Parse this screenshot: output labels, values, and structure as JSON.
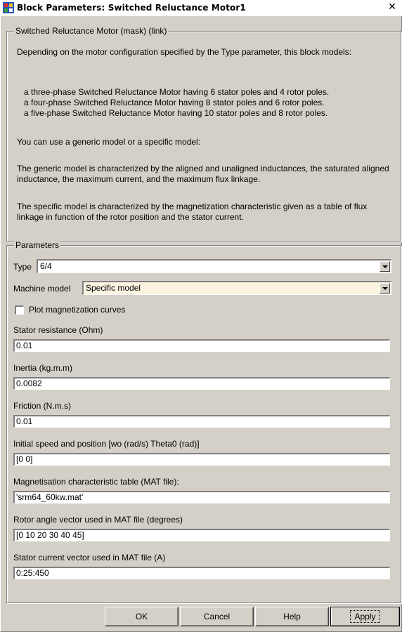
{
  "window": {
    "title": "Block Parameters: Switched Reluctance Motor1",
    "close_glyph": "✕"
  },
  "description_group": {
    "legend": "Switched Reluctance Motor (mask) (link)",
    "paragraphs": [
      "Depending on the motor configuration specified by the Type parameter,  this block models:",
      "a three-phase Switched Reluctance Motor having 6 stator poles and 4 rotor poles.",
      "a four-phase Switched Reluctance Motor having 8 stator poles and 6 rotor poles.",
      "a five-phase Switched Reluctance Motor having 10 stator poles and 8 rotor poles.",
      "You can use a generic model or a specific model:",
      "The generic model is characterized by the aligned and unaligned inductances, the saturated aligned inductance, the maximum current, and the maximum flux linkage.",
      "The specific model is characterized by the magnetization characteristic given as a table of flux linkage in function of the rotor position and the stator current."
    ]
  },
  "parameters_group": {
    "legend": "Parameters",
    "type": {
      "label": "Type",
      "value": "6/4"
    },
    "machine_model": {
      "label": "Machine model",
      "value": "Specific model"
    },
    "plot_checkbox": {
      "label": "Plot magnetization curves",
      "checked": false
    },
    "fields": [
      {
        "label": "Stator resistance (Ohm)",
        "value": "0.01"
      },
      {
        "label": "Inertia (kg.m.m)",
        "value": "0.0082"
      },
      {
        "label": "Friction (N.m.s)",
        "value": "0.01"
      },
      {
        "label": "Initial speed and position [wo (rad/s) Theta0 (rad)]",
        "value": "[0 0]"
      },
      {
        "label": "Magnetisation characteristic table (MAT file):",
        "value": "'srm64_60kw.mat'"
      },
      {
        "label": "Rotor angle vector used in MAT file (degrees)",
        "value": "[0 10 20 30 40 45]"
      },
      {
        "label": "Stator current vector used in MAT file (A)",
        "value": "0:25:450"
      }
    ]
  },
  "buttons": {
    "ok": "OK",
    "cancel": "Cancel",
    "help": "Help",
    "apply": "Apply"
  },
  "colors": {
    "dialog_bg": "#d4d0c8",
    "machine_model_bg": "#fdf5e2"
  },
  "icons": {
    "app": "simulink-block-icon",
    "close": "close-icon",
    "dropdown": "chevron-down-icon"
  }
}
